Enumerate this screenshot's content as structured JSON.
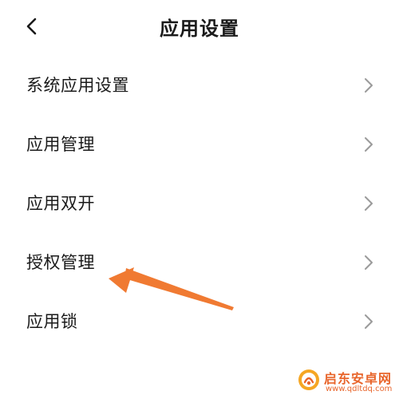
{
  "header": {
    "title": "应用设置",
    "back_icon": "chevron-left-icon"
  },
  "menu": {
    "items": [
      {
        "label": "系统应用设置",
        "icon": "chevron-right-icon"
      },
      {
        "label": "应用管理",
        "icon": "chevron-right-icon"
      },
      {
        "label": "应用双开",
        "icon": "chevron-right-icon"
      },
      {
        "label": "授权管理",
        "icon": "chevron-right-icon"
      },
      {
        "label": "应用锁",
        "icon": "chevron-right-icon"
      }
    ]
  },
  "annotation": {
    "type": "orange-arrow",
    "color": "#f07a32",
    "points_to": "授权管理"
  },
  "watermark": {
    "title": "启东安卓网",
    "url": "www.qdltdq.com",
    "color": "#e8652b"
  },
  "colors": {
    "text": "#1a1a1a",
    "chevron": "#9a9a9a",
    "background": "#ffffff"
  }
}
